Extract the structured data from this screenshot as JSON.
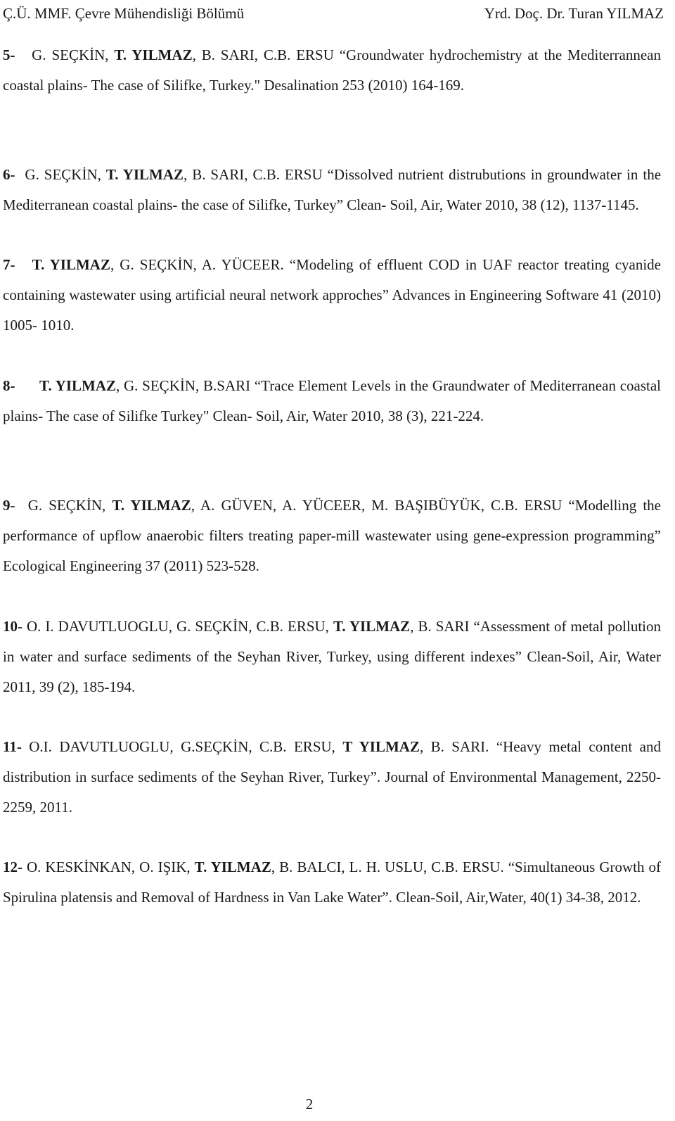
{
  "header": {
    "left": "Ç.Ü. MMF. Çevre Mühendisliği Bölümü",
    "right": "Yrd. Doç. Dr. Turan YILMAZ"
  },
  "entries": [
    {
      "num": "5-",
      "gap": "   ",
      "pre": "G. SEÇKİN, ",
      "bold": "T. YILMAZ",
      "post": ", B. SARI, C.B. ERSU “Groundwater hydrochemistry at the Mediterrannean coastal plains- The case of Silifke, Turkey.\" Desalination 253 (2010) 164-169."
    },
    {
      "num": "6-",
      "gap": "  ",
      "pre": "G. SEÇKİN, ",
      "bold": "T. YILMAZ",
      "post": ", B. SARI, C.B. ERSU “Dissolved nutrient distrubutions in groundwater in the Mediterranean coastal plains- the case of Silifke, Turkey” Clean- Soil, Air, Water 2010, 38 (12), 1137-1145."
    },
    {
      "num": "7-",
      "gap": "   ",
      "pre": "",
      "bold": "T. YILMAZ",
      "post": ", G. SEÇKİN, A. YÜCEER.  “Modeling of effluent COD in UAF reactor treating cyanide containing wastewater using artificial neural network approches” Advances in Engineering Software 41 (2010) 1005- 1010."
    },
    {
      "num": "8-",
      "gap": "      ",
      "pre": "",
      "bold": "T. YILMAZ",
      "post": ",    G. SEÇKİN, B.SARI “Trace Element Levels in the Graundwater of Mediterranean coastal plains- The case of Silifke Turkey\" Clean- Soil, Air, Water 2010, 38 (3), 221-224."
    },
    {
      "num": "9-",
      "gap": "  ",
      "pre": "G. SEÇKİN, ",
      "bold": "T. YILMAZ",
      "post": ", A. GÜVEN, A. YÜCEER, M. BAŞIBÜYÜK, C.B. ERSU “Modelling the performance of upflow anaerobic filters treating paper-mill wastewater using gene-expression programming” Ecological Engineering 37 (2011) 523-528."
    },
    {
      "num": "10-",
      "gap": " ",
      "pre": "O. I. DAVUTLUOGLU, G. SEÇKİN, C.B. ERSU, ",
      "bold": "T. YILMAZ",
      "post": ", B. SARI “Assessment of metal pollution in water and surface sediments of the Seyhan River, Turkey, using different indexes” Clean-Soil, Air, Water 2011, 39 (2), 185-194."
    },
    {
      "num": "11-",
      "gap": " ",
      "pre": "O.I. DAVUTLUOGLU, G.SEÇKİN, C.B. ERSU, ",
      "bold": "T YILMAZ",
      "post": ", B. SARI. “Heavy metal content and distribution in surface sediments of the Seyhan River, Turkey”. Journal of Environmental Management, 2250-2259, 2011."
    },
    {
      "num": "12-",
      "gap": " ",
      "pre": "O. KESKİNKAN, O. IŞIK, ",
      "bold": "T. YILMAZ",
      "post": ", B. BALCI, L. H. USLU, C.B. ERSU. “Simultaneous Growth of Spirulina platensis and Removal of Hardness in Van Lake Water”. Clean-Soil, Air,Water, 40(1) 34-38, 2012."
    }
  ],
  "page_number": "2"
}
